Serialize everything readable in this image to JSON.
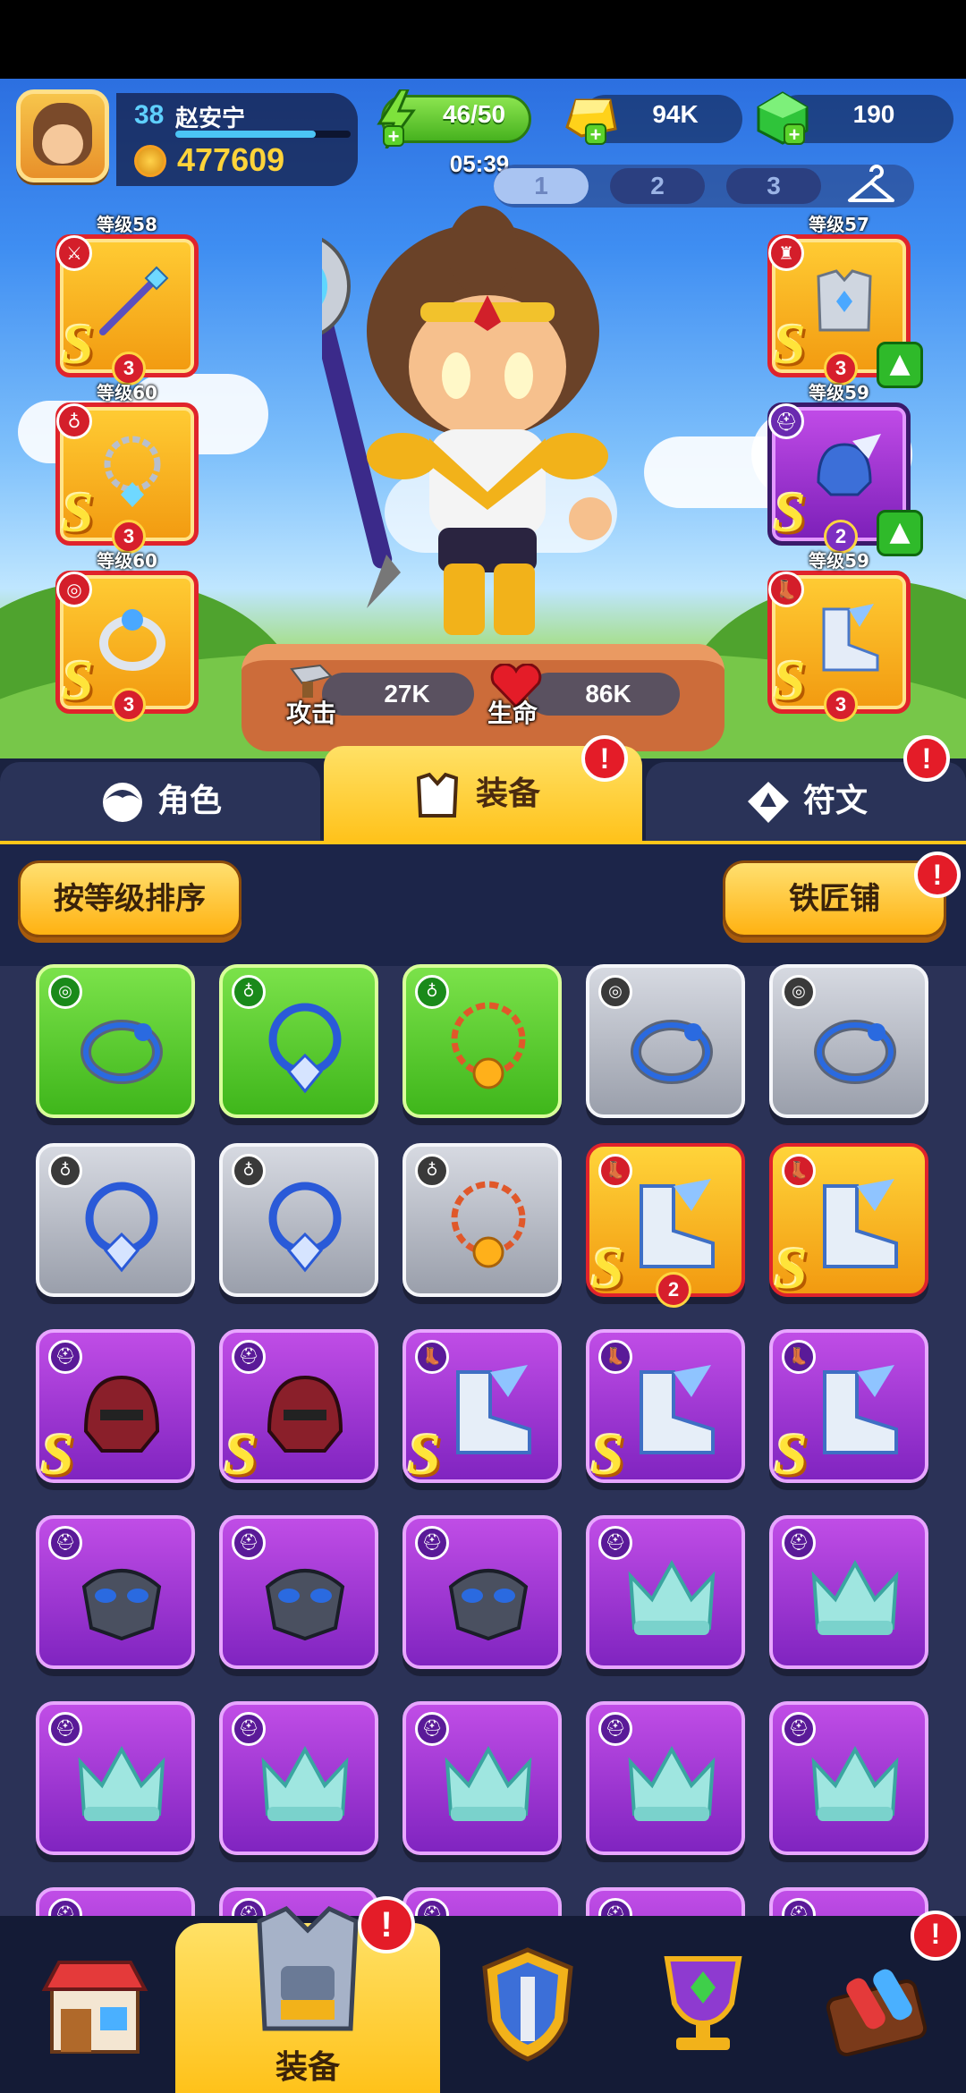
{
  "header": {
    "level": "38",
    "player_name": "赵安宁",
    "xp_fraction": 0.8,
    "gold": "477609",
    "energy": "46/50",
    "timer": "05:39",
    "gold_bars": "94K",
    "gems": "190"
  },
  "loadouts": [
    "1",
    "2",
    "3"
  ],
  "loadout_active": "1",
  "equipped_left": [
    {
      "level": "等级58",
      "tier": "S",
      "stars": "3",
      "item": "staff-icon",
      "category": "weapon-icon"
    },
    {
      "level": "等级60",
      "tier": "S",
      "stars": "3",
      "item": "necklace-icon",
      "category": "necklace-category-icon"
    },
    {
      "level": "等级60",
      "tier": "S",
      "stars": "3",
      "item": "ring-icon",
      "category": "ring-category-icon"
    }
  ],
  "equipped_right": [
    {
      "level": "等级57",
      "tier": "S",
      "stars": "3",
      "item": "armor-icon",
      "category": "armor-category-icon",
      "upgrade": true
    },
    {
      "level": "等级59",
      "tier": "S",
      "stars": "2",
      "item": "helmet-icon",
      "category": "helmet-category-icon",
      "upgrade": true
    },
    {
      "level": "等级59",
      "tier": "S",
      "stars": "3",
      "item": "boots-icon",
      "category": "boots-category-icon",
      "upgrade": false
    }
  ],
  "stats": {
    "attack_label": "攻击",
    "attack_value": "27K",
    "hp_label": "生命",
    "hp_value": "86K"
  },
  "tabs": {
    "character": "角色",
    "equipment": "装备",
    "rune": "符文",
    "alert": "!"
  },
  "toolbar": {
    "sort_label": "按等级排序",
    "blacksmith_label": "铁匠铺"
  },
  "inventory": [
    {
      "rarity": "green",
      "item": "ring-icon"
    },
    {
      "rarity": "green",
      "item": "necklace-icon"
    },
    {
      "rarity": "green",
      "item": "chain-necklace-icon"
    },
    {
      "rarity": "gray",
      "item": "ring-icon"
    },
    {
      "rarity": "gray",
      "item": "ring-icon"
    },
    {
      "rarity": "gray",
      "item": "necklace-icon"
    },
    {
      "rarity": "gray",
      "item": "necklace-icon"
    },
    {
      "rarity": "gray",
      "item": "chain-necklace-icon"
    },
    {
      "rarity": "gold",
      "item": "boots-icon",
      "tier": "S",
      "stars": "2"
    },
    {
      "rarity": "gold",
      "item": "boots-icon",
      "tier": "S"
    },
    {
      "rarity": "purple",
      "item": "helmet-icon",
      "tier": "S"
    },
    {
      "rarity": "purple",
      "item": "helmet-icon",
      "tier": "S"
    },
    {
      "rarity": "purple",
      "item": "boots-icon",
      "tier": "S"
    },
    {
      "rarity": "purple",
      "item": "boots-icon",
      "tier": "S"
    },
    {
      "rarity": "purple",
      "item": "boots-icon",
      "tier": "S"
    },
    {
      "rarity": "purple",
      "item": "mask-icon"
    },
    {
      "rarity": "purple",
      "item": "mask-icon"
    },
    {
      "rarity": "purple",
      "item": "mask-icon"
    },
    {
      "rarity": "purple",
      "item": "crown-icon"
    },
    {
      "rarity": "purple",
      "item": "crown-icon"
    },
    {
      "rarity": "purple",
      "item": "crown-icon"
    },
    {
      "rarity": "purple",
      "item": "crown-icon"
    },
    {
      "rarity": "purple",
      "item": "crown-icon"
    },
    {
      "rarity": "purple",
      "item": "crown-icon"
    },
    {
      "rarity": "purple",
      "item": "crown-icon"
    }
  ],
  "bottom_nav": {
    "equip_label": "装备",
    "alert": "!",
    "items": [
      "shop-icon",
      "equipment-icon",
      "shield-icon",
      "trophy-icon",
      "machine-icon"
    ]
  },
  "colors": {
    "gold_text": "#ffd43a",
    "energy_green": "#47b21f",
    "tab_active": "#ffc21a",
    "alert_red": "#e41c28"
  }
}
